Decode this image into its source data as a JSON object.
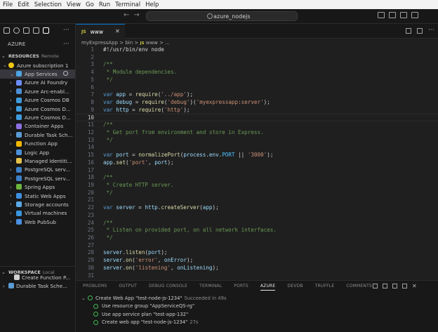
{
  "menubar": [
    "File",
    "Edit",
    "Selection",
    "View",
    "Go",
    "Run",
    "Terminal",
    "Help"
  ],
  "command_center": {
    "search_text": "azure_nodejs",
    "back_arrow": "←",
    "forward_arrow": "→"
  },
  "sidebar": {
    "view_title": "AZURE",
    "resources_header": "RESOURCES",
    "resources_sub": "Remote",
    "subscription": {
      "label": "Azure subscription 1"
    },
    "items": [
      {
        "label": "App Services",
        "icon": "app-services-icon",
        "color": "#4fa3e0"
      },
      {
        "label": "Azure AI Foundry",
        "icon": "ai-foundry-icon",
        "color": "#6b8df5"
      },
      {
        "label": "Azure Arc-enabl...",
        "icon": "arc-icon",
        "color": "#4c8fd6"
      },
      {
        "label": "Azure Cosmos DB",
        "icon": "cosmos-icon",
        "color": "#3f9bdc"
      },
      {
        "label": "Azure Cosmos D...",
        "icon": "cosmos-icon",
        "color": "#3f9bdc"
      },
      {
        "label": "Azure Cosmos D...",
        "icon": "cosmos-icon",
        "color": "#3f9bdc"
      },
      {
        "label": "Container Apps",
        "icon": "container-apps-icon",
        "color": "#8c6fe0"
      },
      {
        "label": "Durable Task Sch...",
        "icon": "durable-task-icon",
        "color": "#5b9bd5"
      },
      {
        "label": "Function App",
        "icon": "function-app-icon",
        "color": "#f2b600"
      },
      {
        "label": "Logic App",
        "icon": "logic-app-icon",
        "color": "#4a8fd8"
      },
      {
        "label": "Managed Identiti...",
        "icon": "identity-icon",
        "color": "#e3c24b"
      },
      {
        "label": "PostgreSQL serv...",
        "icon": "postgres-icon",
        "color": "#3c7fc4"
      },
      {
        "label": "PostgreSQL serv...",
        "icon": "postgres-icon",
        "color": "#3c7fc4"
      },
      {
        "label": "Spring Apps",
        "icon": "spring-icon",
        "color": "#6db33f"
      },
      {
        "label": "Static Web Apps",
        "icon": "static-web-icon",
        "color": "#3f8fe0"
      },
      {
        "label": "Storage accounts",
        "icon": "storage-icon",
        "color": "#5aa9e6"
      },
      {
        "label": "Virtual machines",
        "icon": "vm-icon",
        "color": "#3a96dd"
      },
      {
        "label": "Web PubSub",
        "icon": "web-pubsub-icon",
        "color": "#4a90e2"
      }
    ],
    "workspace_header": "WORKSPACE",
    "workspace_sub": "Local",
    "workspace_items": [
      {
        "label": "Create Function P...",
        "icon": "create-function-icon",
        "color": "#d0d0d0"
      },
      {
        "label": "Durable Task Sche...",
        "icon": "durable-task-icon",
        "color": "#5b9bd5"
      }
    ]
  },
  "editor": {
    "tab": {
      "label": "www",
      "badge": "JS"
    },
    "breadcrumb": {
      "folder1": "myExpressApp",
      "folder2": "bin",
      "badge": "JS",
      "file": "www",
      "tail": "..."
    },
    "current_line": 10,
    "lines": [
      {
        "n": "1",
        "t": [
          [
            "t-txt",
            "#!/usr/bin/env node"
          ]
        ]
      },
      {
        "n": "2",
        "t": []
      },
      {
        "n": "3",
        "t": [
          [
            "t-com",
            "/**"
          ]
        ]
      },
      {
        "n": "4",
        "t": [
          [
            "t-com",
            " * Module dependencies."
          ]
        ]
      },
      {
        "n": "5",
        "t": [
          [
            "t-com",
            " */"
          ]
        ]
      },
      {
        "n": "6",
        "t": []
      },
      {
        "n": "7",
        "t": [
          [
            "t-kw",
            "var"
          ],
          [
            "t-txt",
            " "
          ],
          [
            "t-id",
            "app"
          ],
          [
            "t-txt",
            " = "
          ],
          [
            "t-fn",
            "require"
          ],
          [
            "t-txt",
            "("
          ],
          [
            "t-str",
            "'../app'"
          ],
          [
            "t-txt",
            ");"
          ]
        ]
      },
      {
        "n": "8",
        "t": [
          [
            "t-kw",
            "var"
          ],
          [
            "t-txt",
            " "
          ],
          [
            "t-id",
            "debug"
          ],
          [
            "t-txt",
            " = "
          ],
          [
            "t-fn",
            "require"
          ],
          [
            "t-txt",
            "("
          ],
          [
            "t-str",
            "'debug'"
          ],
          [
            "t-txt",
            ")("
          ],
          [
            "t-str",
            "'myexpressapp:server'"
          ],
          [
            "t-txt",
            ");"
          ]
        ]
      },
      {
        "n": "9",
        "t": [
          [
            "t-kw",
            "var"
          ],
          [
            "t-txt",
            " "
          ],
          [
            "t-id",
            "http"
          ],
          [
            "t-txt",
            " = "
          ],
          [
            "t-fn",
            "require"
          ],
          [
            "t-txt",
            "("
          ],
          [
            "t-str",
            "'http'"
          ],
          [
            "t-txt",
            ");"
          ]
        ]
      },
      {
        "n": "10",
        "t": []
      },
      {
        "n": "11",
        "t": [
          [
            "t-com",
            "/**"
          ]
        ]
      },
      {
        "n": "12",
        "t": [
          [
            "t-com",
            " * Get port from environment and store in Express."
          ]
        ]
      },
      {
        "n": "13",
        "t": [
          [
            "t-com",
            " */"
          ]
        ]
      },
      {
        "n": "14",
        "t": []
      },
      {
        "n": "15",
        "t": [
          [
            "t-kw",
            "var"
          ],
          [
            "t-txt",
            " "
          ],
          [
            "t-id",
            "port"
          ],
          [
            "t-txt",
            " = "
          ],
          [
            "t-fn",
            "normalizePort"
          ],
          [
            "t-txt",
            "("
          ],
          [
            "t-id",
            "process"
          ],
          [
            "t-txt",
            "."
          ],
          [
            "t-id",
            "env"
          ],
          [
            "t-txt",
            "."
          ],
          [
            "t-var",
            "PORT"
          ],
          [
            "t-txt",
            " || "
          ],
          [
            "t-str",
            "'3000'"
          ],
          [
            "t-txt",
            ");"
          ]
        ]
      },
      {
        "n": "16",
        "t": [
          [
            "t-id",
            "app"
          ],
          [
            "t-txt",
            "."
          ],
          [
            "t-fn",
            "set"
          ],
          [
            "t-txt",
            "("
          ],
          [
            "t-str",
            "'port'"
          ],
          [
            "t-txt",
            ", "
          ],
          [
            "t-id",
            "port"
          ],
          [
            "t-txt",
            ");"
          ]
        ]
      },
      {
        "n": "17",
        "t": []
      },
      {
        "n": "18",
        "t": [
          [
            "t-com",
            "/**"
          ]
        ]
      },
      {
        "n": "19",
        "t": [
          [
            "t-com",
            " * Create HTTP server."
          ]
        ]
      },
      {
        "n": "20",
        "t": [
          [
            "t-com",
            " */"
          ]
        ]
      },
      {
        "n": "21",
        "t": []
      },
      {
        "n": "22",
        "t": [
          [
            "t-kw",
            "var"
          ],
          [
            "t-txt",
            " "
          ],
          [
            "t-id",
            "server"
          ],
          [
            "t-txt",
            " = "
          ],
          [
            "t-id",
            "http"
          ],
          [
            "t-txt",
            "."
          ],
          [
            "t-fn",
            "createServer"
          ],
          [
            "t-txt",
            "("
          ],
          [
            "t-id",
            "app"
          ],
          [
            "t-txt",
            ");"
          ]
        ]
      },
      {
        "n": "23",
        "t": []
      },
      {
        "n": "24",
        "t": [
          [
            "t-com",
            "/**"
          ]
        ]
      },
      {
        "n": "25",
        "t": [
          [
            "t-com",
            " * Listen on provided port, on all network interfaces."
          ]
        ]
      },
      {
        "n": "26",
        "t": [
          [
            "t-com",
            " */"
          ]
        ]
      },
      {
        "n": "27",
        "t": []
      },
      {
        "n": "28",
        "t": [
          [
            "t-id",
            "server"
          ],
          [
            "t-txt",
            "."
          ],
          [
            "t-fn",
            "listen"
          ],
          [
            "t-txt",
            "("
          ],
          [
            "t-id",
            "port"
          ],
          [
            "t-txt",
            ");"
          ]
        ]
      },
      {
        "n": "29",
        "t": [
          [
            "t-id",
            "server"
          ],
          [
            "t-txt",
            "."
          ],
          [
            "t-fn",
            "on"
          ],
          [
            "t-txt",
            "("
          ],
          [
            "t-str",
            "'error'"
          ],
          [
            "t-txt",
            ", "
          ],
          [
            "t-id",
            "onError"
          ],
          [
            "t-txt",
            ");"
          ]
        ]
      },
      {
        "n": "30",
        "t": [
          [
            "t-id",
            "server"
          ],
          [
            "t-txt",
            "."
          ],
          [
            "t-fn",
            "on"
          ],
          [
            "t-txt",
            "("
          ],
          [
            "t-str",
            "'listening'"
          ],
          [
            "t-txt",
            ", "
          ],
          [
            "t-id",
            "onListening"
          ],
          [
            "t-txt",
            ");"
          ]
        ]
      },
      {
        "n": "31",
        "t": []
      }
    ]
  },
  "panel": {
    "tabs": [
      "PROBLEMS",
      "OUTPUT",
      "DEBUG CONSOLE",
      "TERMINAL",
      "PORTS",
      "AZURE",
      "DEVDB",
      "TRUFFLE",
      "COMMENTS"
    ],
    "active_tab": "AZURE",
    "activity": {
      "title": "Create Web App \"test-node-js-1234\"",
      "status": "Succeeded in 49s",
      "steps": [
        {
          "label": "Use resource group \"AppServiceQS-rg\"",
          "meta": ""
        },
        {
          "label": "Use app service plan \"test-app-132\"",
          "meta": ""
        },
        {
          "label": "Create web app \"test-node-js-1234\"",
          "meta": "27s"
        }
      ]
    }
  }
}
